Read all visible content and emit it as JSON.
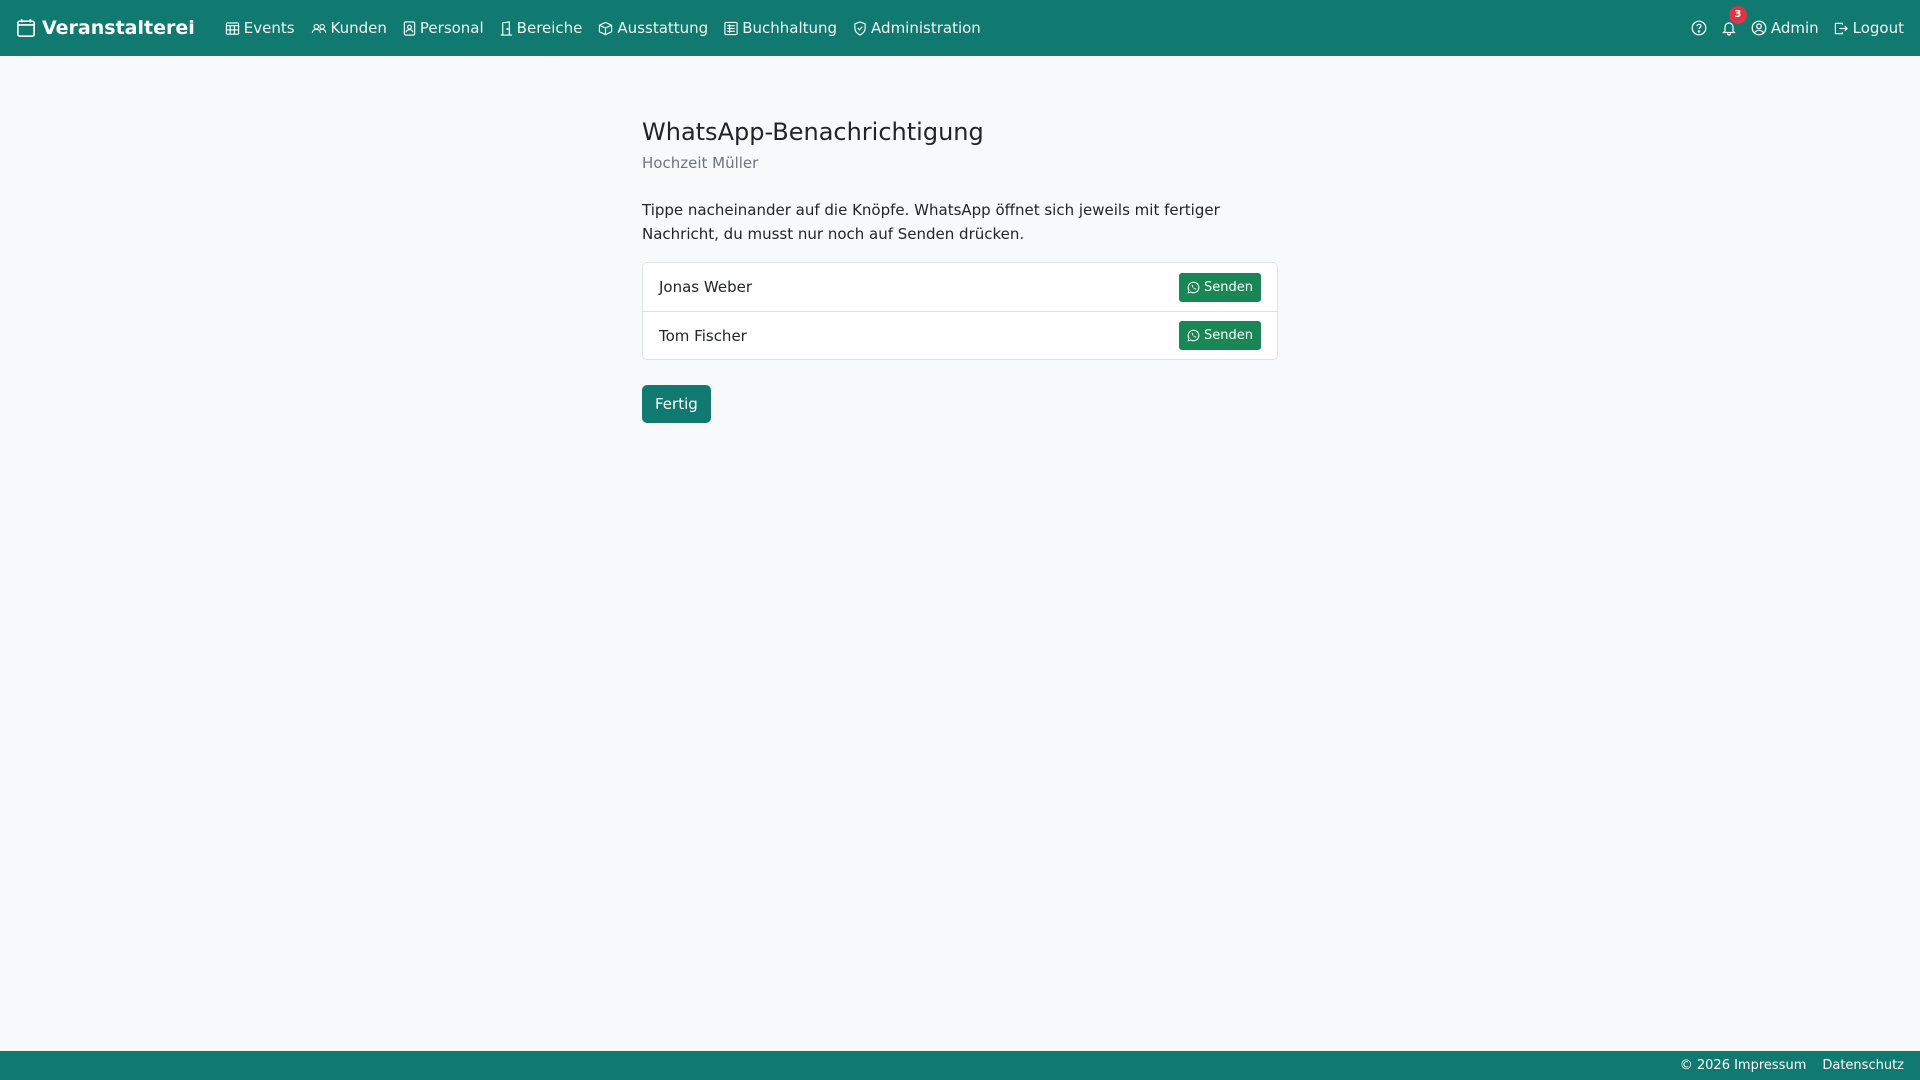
{
  "navbar": {
    "brand": "Veranstalterei",
    "items": [
      {
        "label": "Events",
        "icon": "calendar-grid-icon"
      },
      {
        "label": "Kunden",
        "icon": "people-icon"
      },
      {
        "label": "Personal",
        "icon": "person-badge-icon"
      },
      {
        "label": "Bereiche",
        "icon": "door-icon"
      },
      {
        "label": "Ausstattung",
        "icon": "box-icon"
      },
      {
        "label": "Buchhaltung",
        "icon": "ledger-icon"
      },
      {
        "label": "Administration",
        "icon": "shield-icon"
      }
    ],
    "notifications_count": "3",
    "user_label": "Admin",
    "logout_label": "Logout"
  },
  "main": {
    "title": "WhatsApp-Benachrichtigung",
    "subtitle": "Hochzeit Müller",
    "instructions": "Tippe nacheinander auf die Knöpfe. WhatsApp öffnet sich jeweils mit fertiger Nachricht, du musst nur noch auf Senden drücken.",
    "recipients": [
      {
        "name": "Jonas Weber",
        "button_label": "Senden"
      },
      {
        "name": "Tom Fischer",
        "button_label": "Senden"
      }
    ],
    "done_label": "Fertig"
  },
  "footer": {
    "copyright": "© 2026 Impressum",
    "privacy": "Datenschutz"
  },
  "colors": {
    "primary": "#117a70",
    "send": "#198754",
    "badge": "#dc3545",
    "background": "#f8f9fa"
  }
}
